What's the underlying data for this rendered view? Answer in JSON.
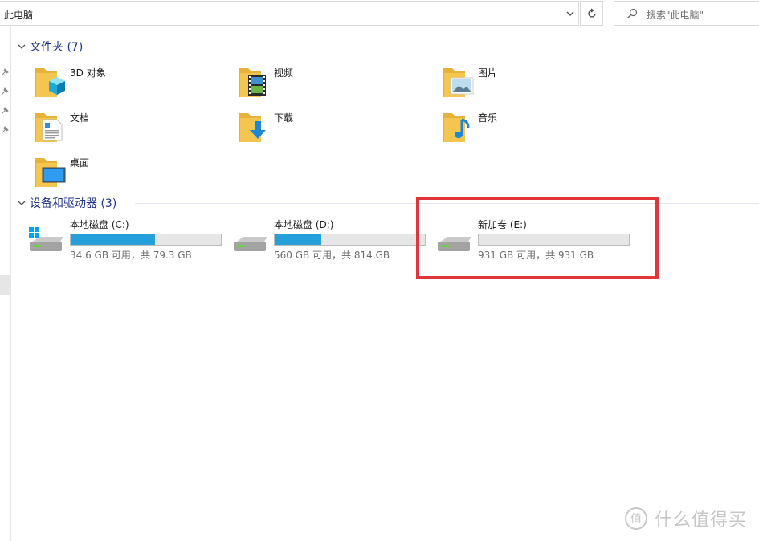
{
  "address_bar": {
    "path": "此电脑"
  },
  "search": {
    "placeholder": "搜索\"此电脑\""
  },
  "groups": {
    "folders": {
      "title": "文件夹 (7)"
    },
    "devices": {
      "title": "设备和驱动器 (3)"
    }
  },
  "folders": [
    {
      "label": "3D 对象",
      "icon": "folder-3d-objects-icon"
    },
    {
      "label": "视频",
      "icon": "folder-videos-icon"
    },
    {
      "label": "图片",
      "icon": "folder-pictures-icon"
    },
    {
      "label": "文档",
      "icon": "folder-documents-icon"
    },
    {
      "label": "下载",
      "icon": "folder-downloads-icon"
    },
    {
      "label": "音乐",
      "icon": "folder-music-icon"
    },
    {
      "label": "桌面",
      "icon": "folder-desktop-icon"
    }
  ],
  "drives": [
    {
      "name": "本地磁盘 (C:)",
      "free_text": "34.6 GB 可用，共 79.3 GB",
      "used_fraction": 0.564,
      "icon": "windows-drive-icon"
    },
    {
      "name": "本地磁盘 (D:)",
      "free_text": "560 GB 可用，共 814 GB",
      "used_fraction": 0.312,
      "icon": "hard-drive-icon"
    },
    {
      "name": "新加卷 (E:)",
      "free_text": "931 GB 可用，共 931 GB",
      "used_fraction": 0.0,
      "icon": "hard-drive-icon"
    }
  ],
  "watermark": {
    "text": "什么值得买"
  },
  "colors": {
    "accent": "#26a0da",
    "group_title": "#1e3287",
    "highlight": "#e0363b",
    "folder": "#f5c64f"
  }
}
